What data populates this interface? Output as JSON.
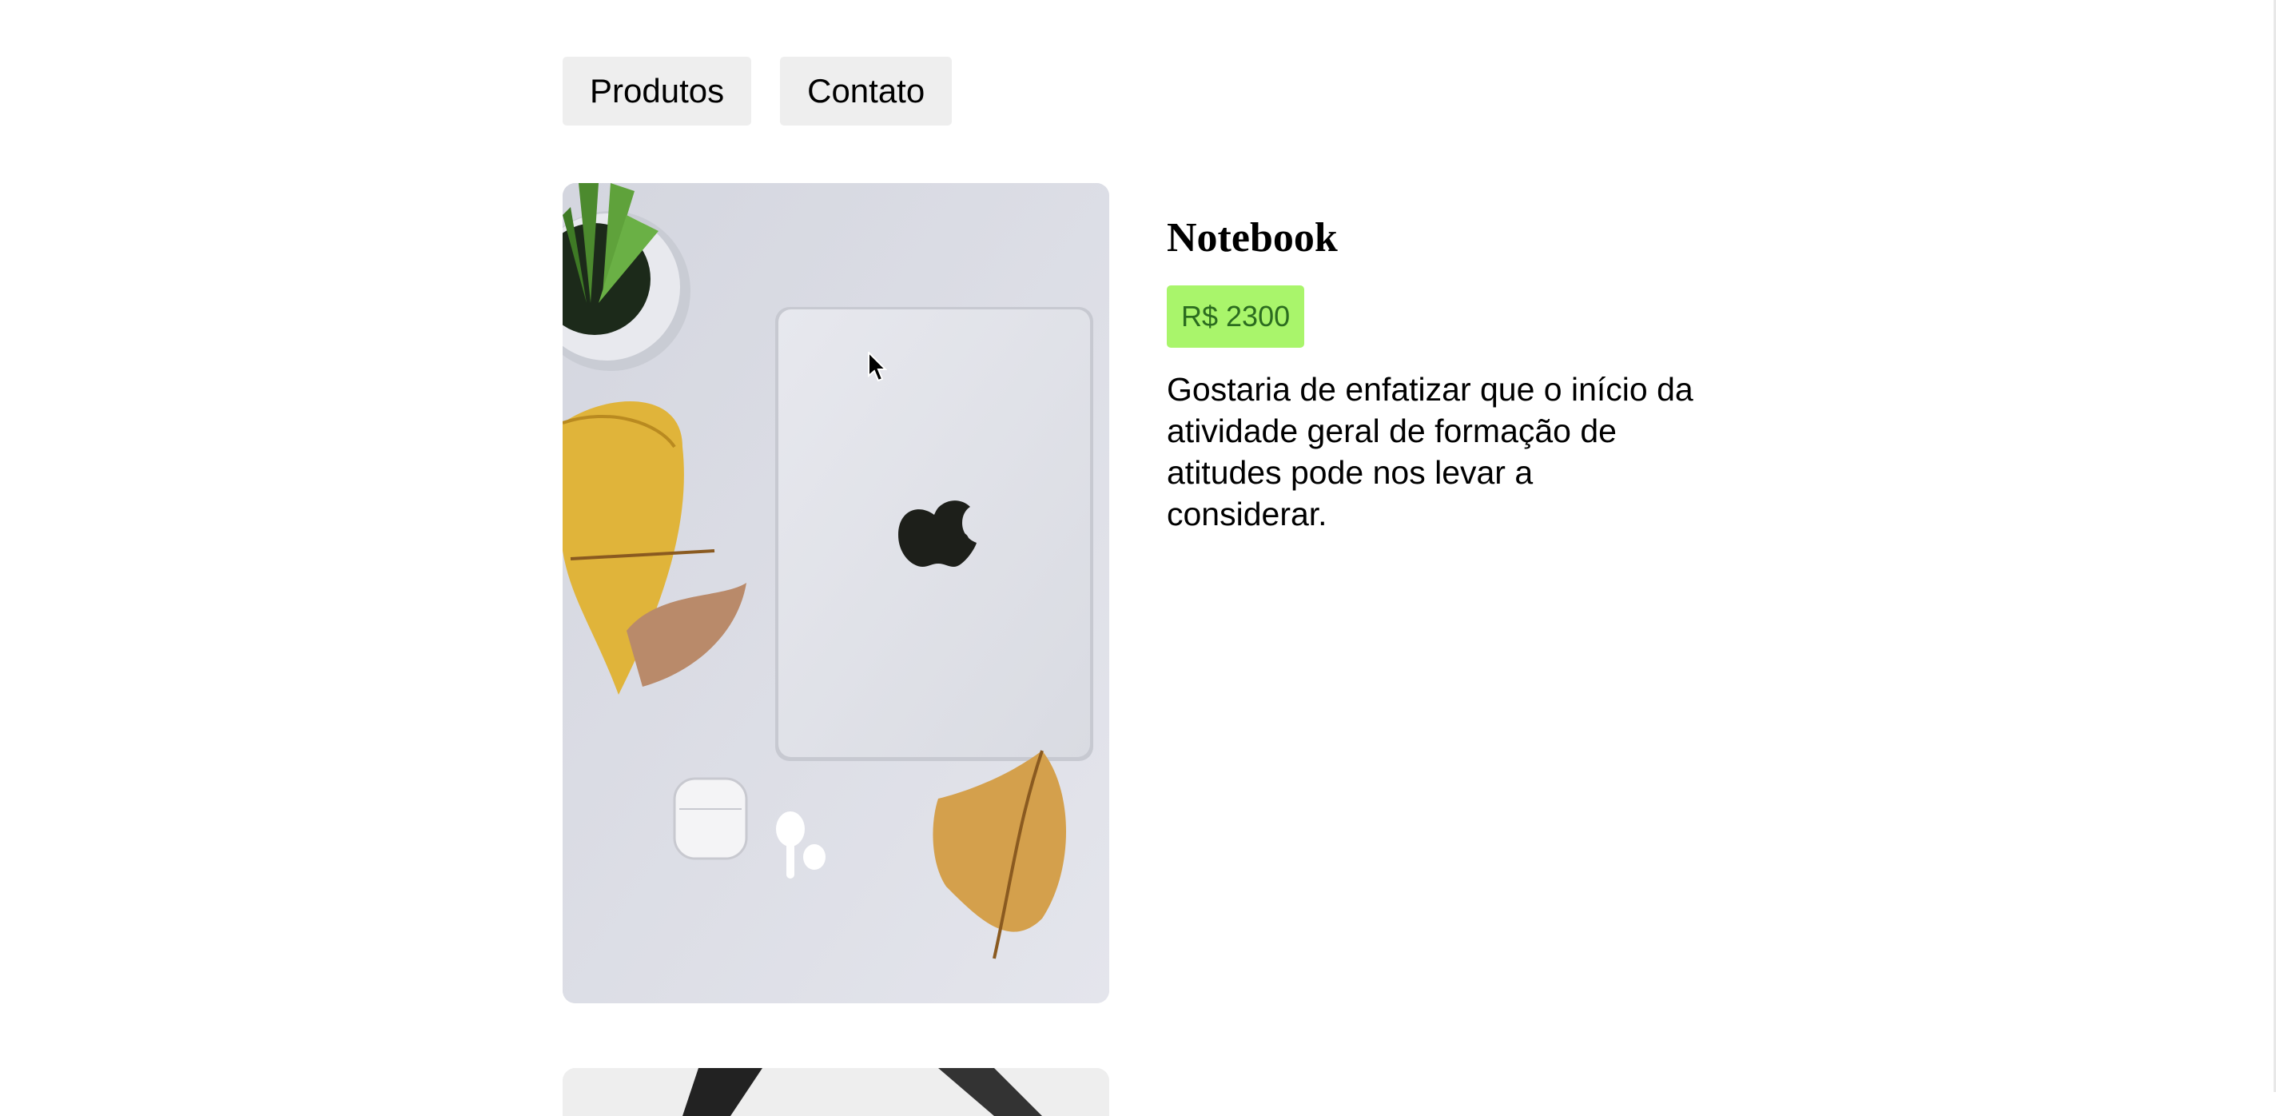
{
  "nav": {
    "items": [
      {
        "label": "Produtos"
      },
      {
        "label": "Contato"
      }
    ]
  },
  "product": {
    "title": "Notebook",
    "price": "R$ 2300",
    "description": "Gostaria de enfatizar que o início da atividade geral de formação de atitudes pode nos levar a considerar.",
    "image_icon": "laptop-photo"
  },
  "colors": {
    "price_badge_bg": "#a9f56b",
    "price_badge_text": "#2b6c1f",
    "nav_button_bg": "#eeeeee"
  }
}
